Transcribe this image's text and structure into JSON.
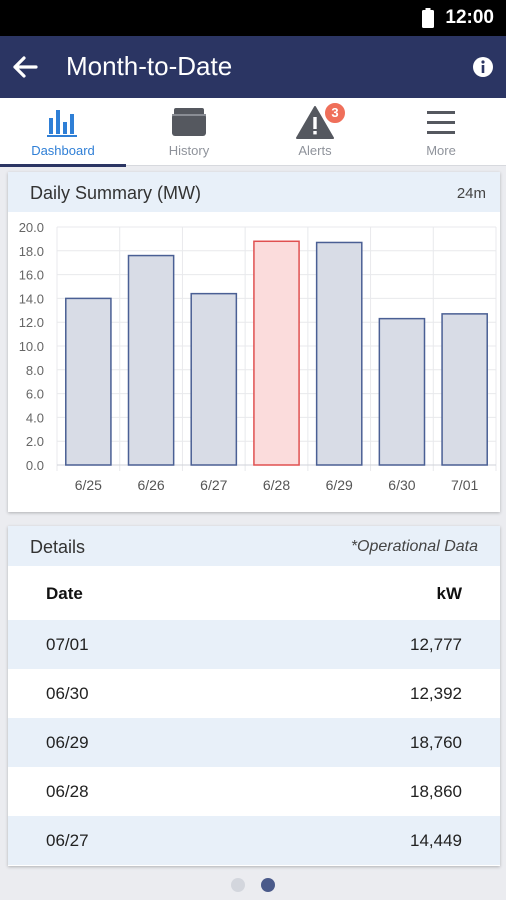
{
  "status": {
    "time": "12:00"
  },
  "appbar": {
    "title": "Month-to-Date"
  },
  "tabs": [
    {
      "label": "Dashboard",
      "icon": "bar-chart-icon",
      "active": true
    },
    {
      "label": "History",
      "icon": "archive-box-icon"
    },
    {
      "label": "Alerts",
      "icon": "warning-icon",
      "badge": "3"
    },
    {
      "label": "More",
      "icon": "menu-icon"
    }
  ],
  "summary": {
    "title": "Daily Summary (MW)",
    "refresh": "24m"
  },
  "chart_data": {
    "type": "bar",
    "categories": [
      "6/25",
      "6/26",
      "6/27",
      "6/28",
      "6/29",
      "6/30",
      "7/01"
    ],
    "values": [
      14.0,
      17.6,
      14.4,
      18.8,
      18.7,
      12.3,
      12.7
    ],
    "highlight_index": 3,
    "ylim": [
      0,
      20
    ],
    "yticks": [
      "0.0",
      "2.0",
      "4.0",
      "6.0",
      "8.0",
      "10.0",
      "12.0",
      "14.0",
      "16.0",
      "18.0",
      "20.0"
    ],
    "grid": true,
    "colors": {
      "bar_fill": "#d8dce6",
      "bar_stroke": "#4a5f94",
      "highlight_fill": "#fbdcdc",
      "highlight_stroke": "#e05050"
    }
  },
  "details": {
    "title": "Details",
    "note": "*Operational Data",
    "columns": {
      "date": "Date",
      "value": "kW"
    },
    "rows": [
      {
        "date": "07/01",
        "value": "12,777"
      },
      {
        "date": "06/30",
        "value": "12,392"
      },
      {
        "date": "06/29",
        "value": "18,760"
      },
      {
        "date": "06/28",
        "value": "18,860"
      },
      {
        "date": "06/27",
        "value": "14,449"
      }
    ]
  },
  "pager": {
    "count": 2,
    "active": 1
  },
  "colors": {
    "appbar": "#2b3563",
    "accent": "#2f7fd6",
    "badge": "#ef6f5a"
  }
}
